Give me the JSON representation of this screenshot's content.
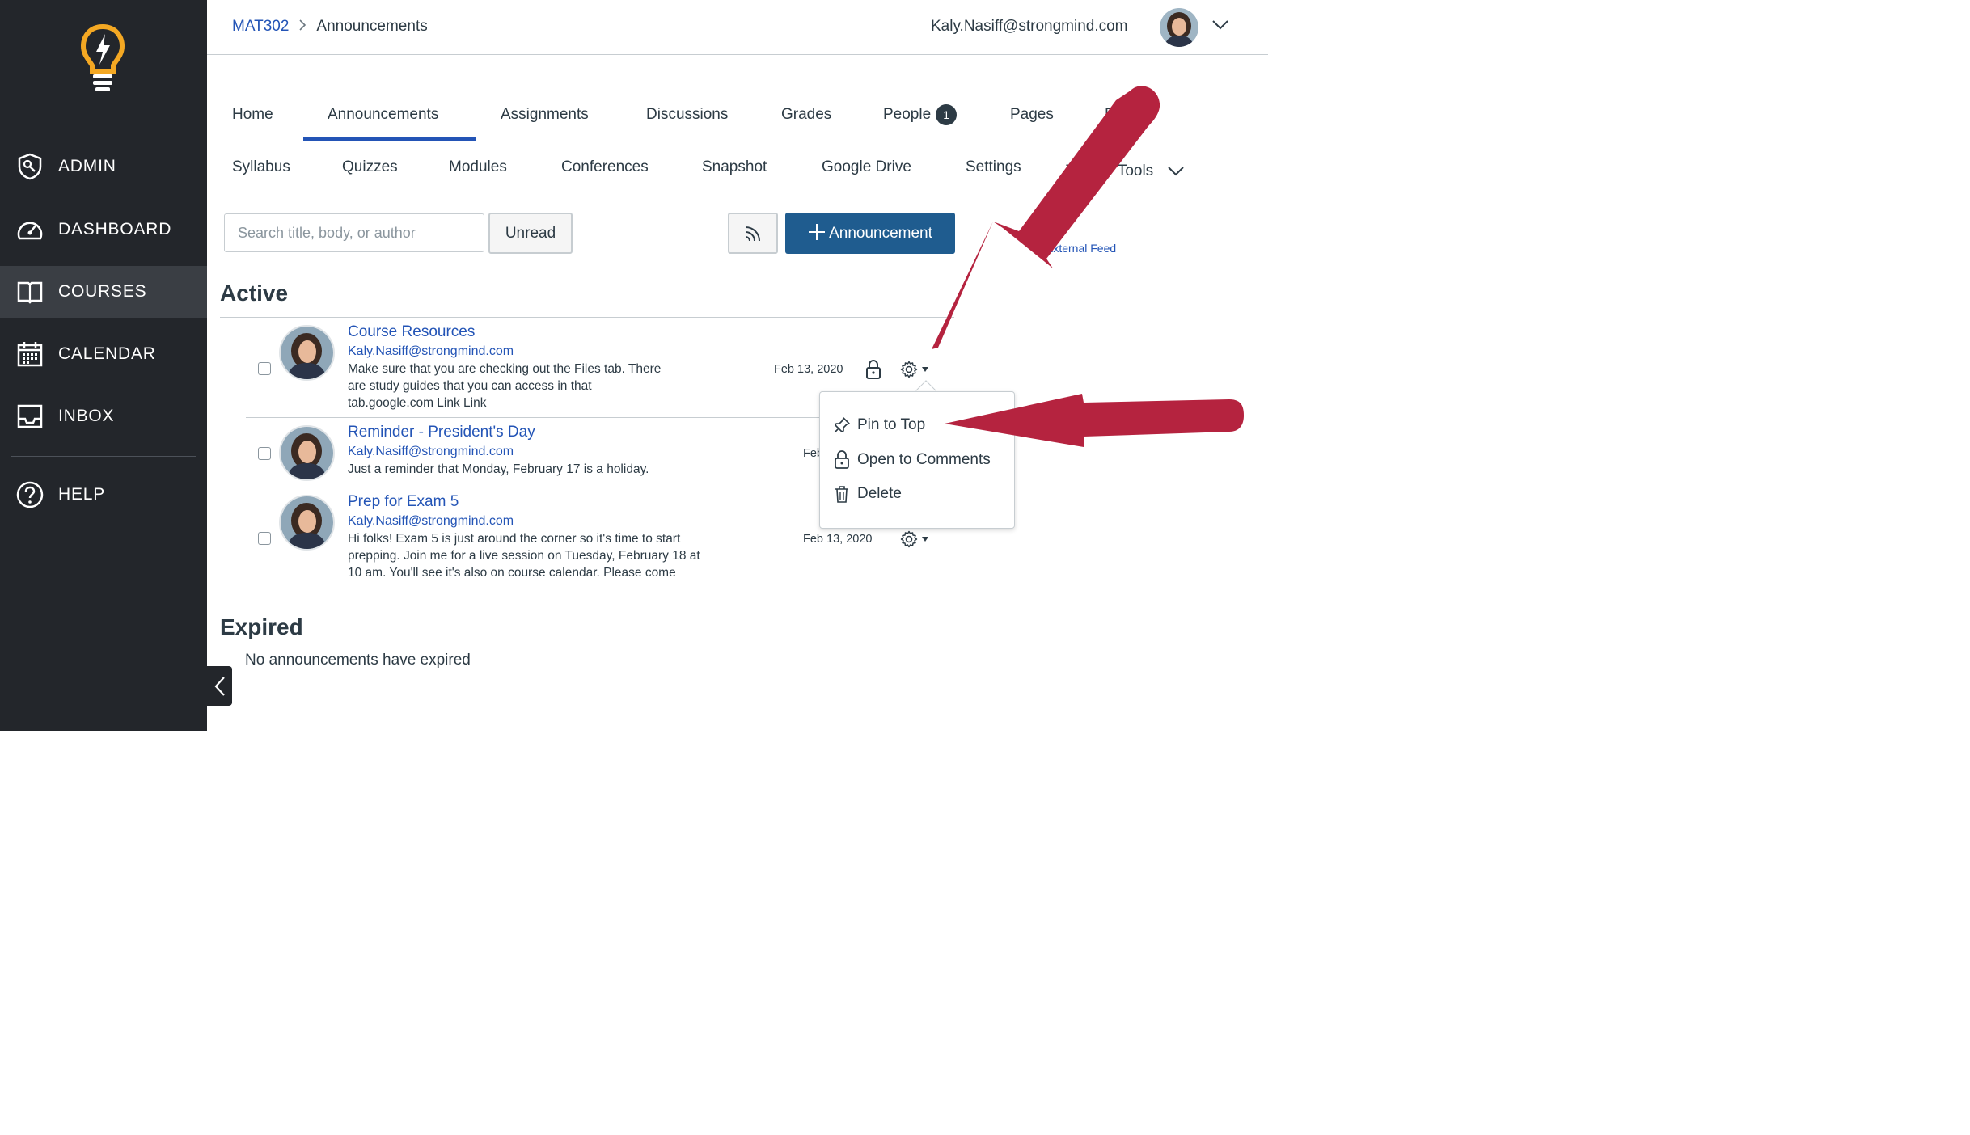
{
  "sidebar": {
    "items": [
      {
        "label": "ADMIN",
        "icon": "shield-icon"
      },
      {
        "label": "DASHBOARD",
        "icon": "speedometer-icon"
      },
      {
        "label": "COURSES",
        "icon": "book-icon",
        "active": true
      },
      {
        "label": "CALENDAR",
        "icon": "calendar-icon"
      },
      {
        "label": "INBOX",
        "icon": "inbox-icon"
      },
      {
        "label": "HELP",
        "icon": "help-icon"
      }
    ]
  },
  "header": {
    "breadcrumb": {
      "course": "MAT302",
      "current": "Announcements"
    },
    "user_email": "Kaly.Nasiff@strongmind.com"
  },
  "tabs": {
    "row1": [
      "Home",
      "Announcements",
      "Assignments",
      "Discussions",
      "Grades",
      "People",
      "Pages",
      "Fi"
    ],
    "people_badge": "1",
    "row2": [
      "Syllabus",
      "Quizzes",
      "Modules",
      "Conferences",
      "Snapshot",
      "Google Drive",
      "Settings",
      "Te",
      "er Tools"
    ]
  },
  "toolbar": {
    "search_placeholder": "Search title, body, or author",
    "unread_label": "Unread",
    "add_label": "Announcement",
    "external_feed": "External Feed"
  },
  "sections": {
    "active_title": "Active",
    "expired_title": "Expired",
    "no_expired": "No announcements have expired"
  },
  "announcements": [
    {
      "title": "Course Resources",
      "author": "Kaly.Nasiff@strongmind.com",
      "body": "Make sure that you are checking out the Files tab. There are study guides that you can access in that tab.google.com Link Link",
      "date": "Feb 13, 2020"
    },
    {
      "title": "Reminder - President's Day",
      "author": "Kaly.Nasiff@strongmind.com",
      "body": "Just a reminder that Monday, February 17 is a holiday.",
      "date": "Feb"
    },
    {
      "title": "Prep for Exam 5",
      "author": "Kaly.Nasiff@strongmind.com",
      "body": "Hi folks! Exam 5 is just around the corner so it's time to start prepping. Join me for a live session on Tuesday, February 18 at 10 am. You'll see it's also on course calendar. Please come",
      "date": "Feb 13, 2020"
    }
  ],
  "menu": {
    "items": [
      {
        "label": "Pin to Top",
        "icon": "pin-icon"
      },
      {
        "label": "Open to Comments",
        "icon": "lock-icon"
      },
      {
        "label": "Delete",
        "icon": "trash-icon"
      }
    ]
  },
  "colors": {
    "sidebar_bg": "#23262b",
    "link_blue": "#2354b6",
    "primary_button": "#1f5c8f",
    "arrow_red": "#b5233f",
    "logo_gold": "#f4a823"
  }
}
